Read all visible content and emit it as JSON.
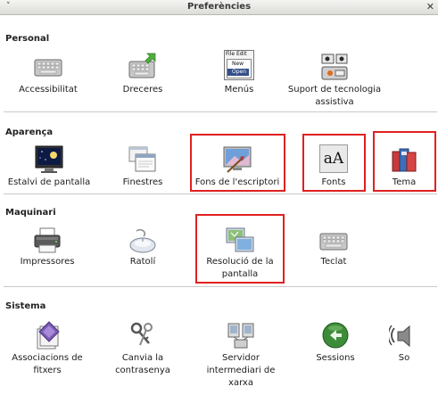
{
  "window": {
    "title": "Preferències",
    "menu_arrow": "˅",
    "close": "✕"
  },
  "sections": [
    {
      "title": "Personal",
      "items": [
        {
          "label": "Accessibilitat",
          "icon": "keyboard-accessibility-icon"
        },
        {
          "label": "Dreceres",
          "icon": "keyboard-shortcuts-icon"
        },
        {
          "label": "Menús",
          "icon": "menu-editor-icon",
          "menu_text": [
            "File",
            "Edit",
            "New",
            "Open"
          ]
        },
        {
          "label": "Suport de tecnologia assistiva",
          "icon": "assistive-technology-icon"
        }
      ]
    },
    {
      "title": "Aparença",
      "items": [
        {
          "label": "Estalvi de pantalla",
          "icon": "screensaver-icon"
        },
        {
          "label": "Finestres",
          "icon": "windows-icon"
        },
        {
          "label": "Fons de l'escriptori",
          "icon": "desktop-background-icon"
        },
        {
          "label": "Fonts",
          "icon": "fonts-icon",
          "glyph": "aA"
        },
        {
          "label": "Tema",
          "icon": "theme-icon"
        }
      ]
    },
    {
      "title": "Maquinari",
      "items": [
        {
          "label": "Impressores",
          "icon": "printer-icon"
        },
        {
          "label": "Ratolí",
          "icon": "mouse-icon"
        },
        {
          "label": "Resolució de la pantalla",
          "icon": "screen-resolution-icon"
        },
        {
          "label": "Teclat",
          "icon": "keyboard-icon"
        }
      ]
    },
    {
      "title": "Sistema",
      "items": [
        {
          "label": "Associacions de fitxers",
          "icon": "file-associations-icon"
        },
        {
          "label": "Canvia la contrasenya",
          "icon": "change-password-icon"
        },
        {
          "label": "Servidor intermediari de xarxa",
          "icon": "network-proxy-icon"
        },
        {
          "label": "Sessions",
          "icon": "sessions-icon"
        },
        {
          "label": "So",
          "icon": "sound-icon"
        }
      ]
    }
  ],
  "colors": {
    "highlight": "#e02020",
    "separator": "#c9c9c9"
  }
}
